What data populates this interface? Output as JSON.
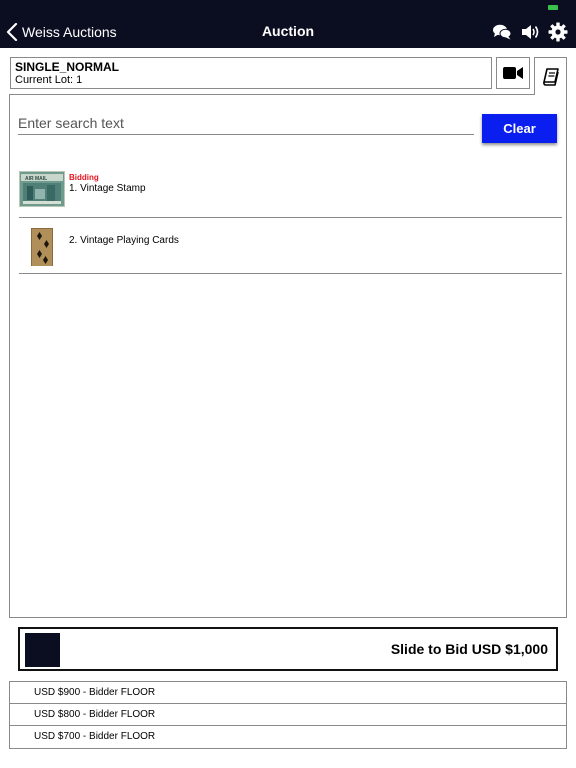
{
  "nav": {
    "back_label": "Weiss Auctions",
    "title": "Auction",
    "icons": [
      "chat-icon",
      "speaker-icon",
      "gear-icon"
    ],
    "bar_color": "#0b0e21"
  },
  "session": {
    "name": "SINGLE_NORMAL",
    "current_lot": "Current Lot: 1",
    "buttons": [
      "video-camera-icon",
      "book-icon"
    ]
  },
  "search": {
    "placeholder": "Enter search text",
    "value": "",
    "clear_label": "Clear",
    "clear_color": "#0a1ef0"
  },
  "lots": [
    {
      "status": "Bidding",
      "title": "1. Vintage Stamp",
      "thumbnail": "stamp-thumbnail"
    },
    {
      "status": "",
      "title": "2. Vintage Playing Cards",
      "thumbnail": "playing-cards-thumbnail"
    }
  ],
  "bid": {
    "slide_label": "Slide to Bid USD $1,000"
  },
  "bid_history": [
    "USD $900 - Bidder FLOOR",
    "USD $800 - Bidder FLOOR",
    "USD $700 - Bidder FLOOR"
  ]
}
